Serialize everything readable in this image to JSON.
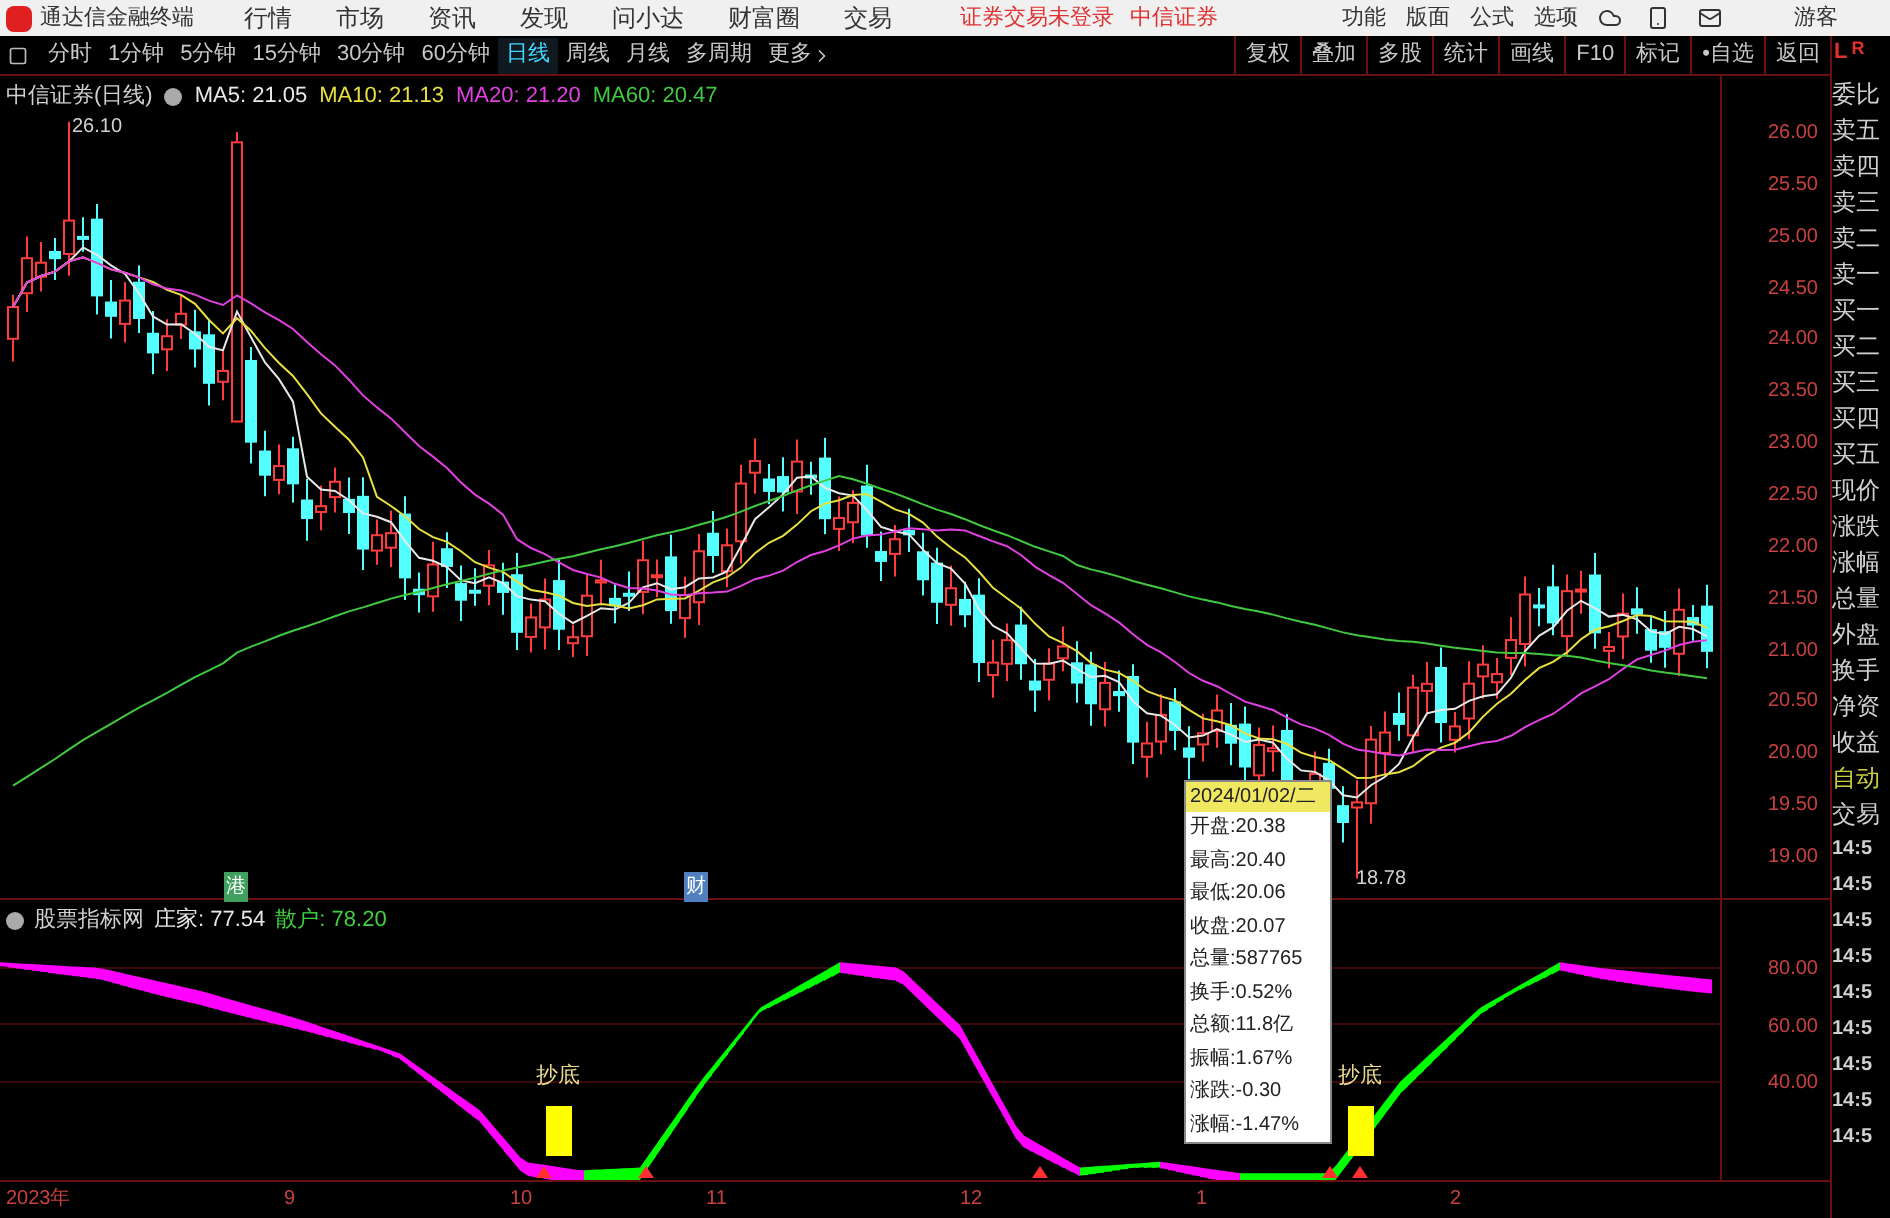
{
  "app_bar": {
    "title": "通达信金融终端",
    "menu": [
      "行情",
      "市场",
      "资讯",
      "发现",
      "问小达",
      "财富圈",
      "交易"
    ],
    "notice": "证券交易未登录",
    "broker": "中信证券",
    "tools": [
      "功能",
      "版面",
      "公式",
      "选项"
    ],
    "user": "游客"
  },
  "period_tabs": [
    {
      "label": "分时",
      "selected": false
    },
    {
      "label": "1分钟",
      "selected": false
    },
    {
      "label": "5分钟",
      "selected": false
    },
    {
      "label": "15分钟",
      "selected": false
    },
    {
      "label": "30分钟",
      "selected": false
    },
    {
      "label": "60分钟",
      "selected": false
    },
    {
      "label": "日线",
      "selected": true
    },
    {
      "label": "周线",
      "selected": false
    },
    {
      "label": "月线",
      "selected": false
    },
    {
      "label": "多周期",
      "selected": false
    },
    {
      "label": "更多",
      "selected": false
    }
  ],
  "chart_toolbar": [
    "复权",
    "叠加",
    "多股",
    "统计",
    "画线",
    "F10",
    "标记",
    "•自选",
    "返回"
  ],
  "quote_header": {
    "title": "中信证券(日线)",
    "ma": [
      {
        "label": "MA5:",
        "value": "21.05",
        "color": "#e8e8e8"
      },
      {
        "label": "MA10:",
        "value": "21.13",
        "color": "#e8e040"
      },
      {
        "label": "MA20:",
        "value": "21.20",
        "color": "#e040e0"
      },
      {
        "label": "MA60:",
        "value": "20.47",
        "color": "#40c840"
      }
    ]
  },
  "price_chart": {
    "high_label": "26.10",
    "low_label": "18.78",
    "price_axis": [
      "26.00",
      "25.50",
      "25.00",
      "24.50",
      "24.00",
      "23.50",
      "23.00",
      "22.50",
      "22.00",
      "21.50",
      "21.00",
      "20.50",
      "20.00",
      "19.50",
      "19.00"
    ],
    "event_marks": [
      {
        "label": "港",
        "color": "#40a060"
      },
      {
        "label": "财",
        "color": "#5080c0"
      }
    ]
  },
  "tooltip": {
    "date": "2024/01/02/二",
    "rows": [
      "开盘:20.38",
      "最高:20.40",
      "最低:20.06",
      "收盘:20.07",
      "总量:587765",
      "换手:0.52%",
      "总额:11.8亿",
      "振幅:1.67%",
      "涨跌:-0.30",
      "涨幅:-1.47%"
    ]
  },
  "indicator": {
    "title": "股票指标网",
    "series": [
      {
        "label": "庄家:",
        "value": "77.54",
        "color": "#e8e8e8"
      },
      {
        "label": "散户:",
        "value": "78.20",
        "color": "#40d040"
      }
    ],
    "axis": [
      "80.00",
      "60.00",
      "40.00"
    ],
    "signals": [
      "抄底",
      "抄底"
    ]
  },
  "time_axis": [
    "2023年",
    "9",
    "10",
    "11",
    "12",
    "1",
    "2"
  ],
  "side_panel": {
    "corner": [
      "L",
      "R"
    ],
    "labels": [
      "委比",
      "卖五",
      "卖四",
      "卖三",
      "卖二",
      "卖一",
      "买一",
      "买二",
      "买三",
      "买四",
      "买五",
      "现价",
      "涨跌",
      "涨幅",
      "总量",
      "外盘",
      "换手",
      "净资",
      "收益"
    ],
    "auto_label": "自动",
    "trade_label": "交易",
    "times": [
      "14:5",
      "14:5",
      "14:5",
      "14:5",
      "14:5",
      "14:5",
      "14:5",
      "14:5",
      "14:5"
    ]
  }
}
